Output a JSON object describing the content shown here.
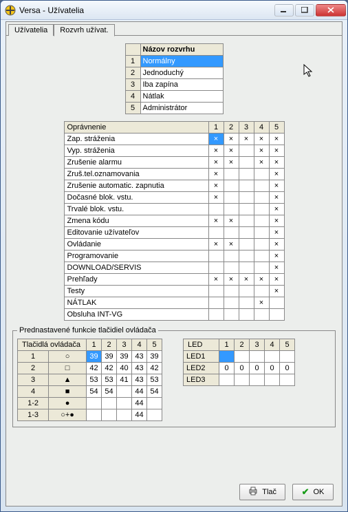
{
  "window": {
    "title": "Versa - Užívatelia"
  },
  "tabs": {
    "left": "Užívatelia",
    "right": "Rozvrh užívat."
  },
  "schedule": {
    "header": "Názov rozvrhu",
    "rows": [
      {
        "n": "1",
        "name": "Normálny",
        "selected": true
      },
      {
        "n": "2",
        "name": "Jednoduchý"
      },
      {
        "n": "3",
        "name": "Iba zapína"
      },
      {
        "n": "4",
        "name": "Nátlak"
      },
      {
        "n": "5",
        "name": "Administrátor"
      }
    ]
  },
  "permissions": {
    "header": "Oprávnenie",
    "cols": [
      "1",
      "2",
      "3",
      "4",
      "5"
    ],
    "rows": [
      {
        "name": "Zap. stráženia",
        "v": [
          "X",
          "X",
          "X",
          "X",
          "X"
        ],
        "sel": 0
      },
      {
        "name": "Vyp. stráženia",
        "v": [
          "X",
          "X",
          "",
          "X",
          "X"
        ]
      },
      {
        "name": "Zrušenie alarmu",
        "v": [
          "X",
          "X",
          "",
          "X",
          "X"
        ]
      },
      {
        "name": "Zruš.tel.oznamovania",
        "v": [
          "X",
          "",
          "",
          "",
          "X"
        ]
      },
      {
        "name": "Zrušenie automatic. zapnutia",
        "v": [
          "X",
          "",
          "",
          "",
          "X"
        ]
      },
      {
        "name": "Dočasné blok. vstu.",
        "v": [
          "X",
          "",
          "",
          "",
          "X"
        ]
      },
      {
        "name": "Trvalé blok. vstu.",
        "v": [
          "",
          "",
          "",
          "",
          "X"
        ]
      },
      {
        "name": "Zmena kódu",
        "v": [
          "X",
          "X",
          "",
          "",
          "X"
        ]
      },
      {
        "name": "Editovanie užívateľov",
        "v": [
          "",
          "",
          "",
          "",
          "X"
        ]
      },
      {
        "name": "Ovládanie",
        "v": [
          "X",
          "X",
          "",
          "",
          "X"
        ]
      },
      {
        "name": "Programovanie",
        "v": [
          "",
          "",
          "",
          "",
          "X"
        ]
      },
      {
        "name": "DOWNLOAD/SERVIS",
        "v": [
          "",
          "",
          "",
          "",
          "X"
        ]
      },
      {
        "name": "Prehľady",
        "v": [
          "X",
          "X",
          "X",
          "X",
          "X"
        ]
      },
      {
        "name": "Testy",
        "v": [
          "",
          "",
          "",
          "",
          "X"
        ]
      },
      {
        "name": "NÁTLAK",
        "v": [
          "",
          "",
          "",
          "X",
          ""
        ]
      },
      {
        "name": "Obsluha INT-VG",
        "v": [
          "",
          "",
          "",
          "",
          ""
        ]
      }
    ]
  },
  "preset": {
    "legend": "Prednastavené funkcie tlačidiel ovládača",
    "btns": {
      "header": "Tlačidlá ovládača",
      "cols": [
        "1",
        "2",
        "3",
        "4",
        "5"
      ],
      "rows": [
        {
          "n": "1",
          "icon": "○",
          "v": [
            "39",
            "39",
            "39",
            "43",
            "39"
          ],
          "sel": 0
        },
        {
          "n": "2",
          "icon": "□",
          "v": [
            "42",
            "42",
            "40",
            "43",
            "42"
          ]
        },
        {
          "n": "3",
          "icon": "▲",
          "v": [
            "53",
            "53",
            "41",
            "43",
            "53"
          ]
        },
        {
          "n": "4",
          "icon": "■",
          "v": [
            "54",
            "54",
            "",
            "44",
            "54"
          ]
        },
        {
          "n": "1-2",
          "icon": "●",
          "v": [
            "",
            "",
            "",
            "44",
            ""
          ]
        },
        {
          "n": "1-3",
          "icon": "○+●",
          "v": [
            "",
            "",
            "",
            "44",
            ""
          ]
        }
      ]
    },
    "led": {
      "header": "LED",
      "cols": [
        "1",
        "2",
        "3",
        "4",
        "5"
      ],
      "rows": [
        {
          "name": "LED1",
          "v": [
            "",
            "",
            "",
            "",
            ""
          ],
          "sel": 0
        },
        {
          "name": "LED2",
          "v": [
            "0",
            "0",
            "0",
            "0",
            "0"
          ]
        },
        {
          "name": "LED3",
          "v": [
            "",
            "",
            "",
            "",
            ""
          ]
        }
      ]
    }
  },
  "footer": {
    "print": "Tlač",
    "ok": "OK"
  }
}
